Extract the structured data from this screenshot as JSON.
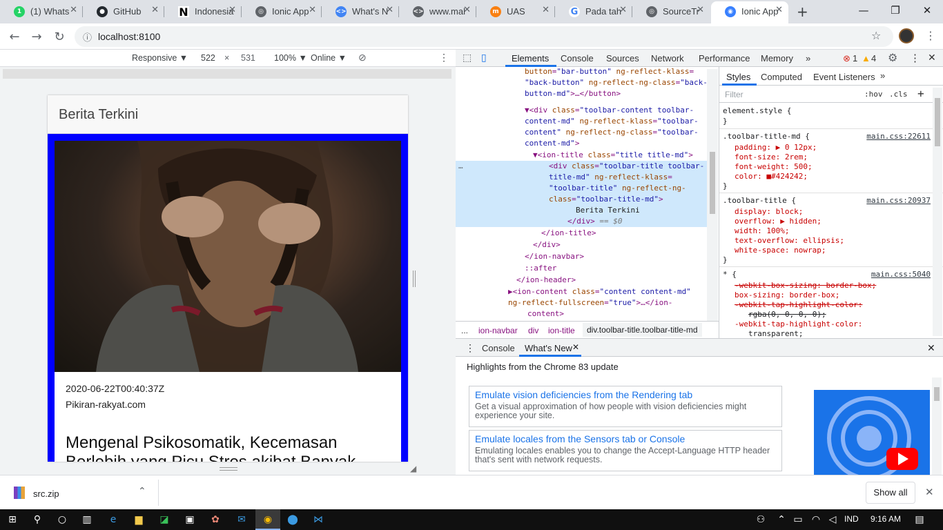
{
  "browser": {
    "tabs": [
      {
        "title": "(1) Whats",
        "favicon": "whatsapp-icon",
        "color": "#25d366"
      },
      {
        "title": "GitHub",
        "favicon": "github-icon",
        "color": "#24292e"
      },
      {
        "title": "Indonesia",
        "favicon": "notion-icon",
        "color": "#000000"
      },
      {
        "title": "Ionic App",
        "favicon": "globe-icon",
        "color": "#5f6368"
      },
      {
        "title": "What's N",
        "favicon": "devtools-icon",
        "color": "#4285f4"
      },
      {
        "title": "www.mal",
        "favicon": "code-icon",
        "color": "#5f6368"
      },
      {
        "title": "UAS",
        "favicon": "moodle-icon",
        "color": "#f98012"
      },
      {
        "title": "Pada tah",
        "favicon": "google-icon",
        "color": "#4285f4"
      },
      {
        "title": "SourceTr",
        "favicon": "globe-icon",
        "color": "#5f6368"
      },
      {
        "title": "Ionic App",
        "favicon": "ionic-icon",
        "color": "#3880ff"
      }
    ],
    "url": "localhost:8100"
  },
  "device_toolbar": {
    "mode": "Responsive ▼",
    "width": "522",
    "sep": "×",
    "height": "531",
    "zoom": "100% ▼",
    "network": "Online ▼"
  },
  "app": {
    "title": "Berita Terkini",
    "card": {
      "date": "2020-06-22T00:40:37Z",
      "source": "Pikiran-rakyat.com",
      "headline": "Mengenal Psikosomatik, Kecemasan Berlebih yang Picu Stres akibat Banyak"
    }
  },
  "devtools": {
    "tabs": [
      "Elements",
      "Console",
      "Sources",
      "Network",
      "Performance",
      "Memory",
      "»"
    ],
    "errors": "1",
    "warnings": "4",
    "breadcrumbs": [
      "...",
      "ion-navbar",
      "div",
      "ion-title",
      "div.toolbar-title.toolbar-title-md"
    ],
    "styles_tabs": [
      "Styles",
      "Computed",
      "Event Listeners",
      "»"
    ],
    "filter_placeholder": "Filter",
    "hov": ":hov",
    "cls": ".cls",
    "drawer_tabs": [
      "Console",
      "What's New"
    ],
    "whats_new_title": "Highlights from the Chrome 83 update",
    "whats_new": [
      {
        "title": "Emulate vision deficiencies from the Rendering tab",
        "desc": "Get a visual approximation of how people with vision deficiencies might experience your site."
      },
      {
        "title": "Emulate locales from the Sensors tab or Console",
        "desc": "Emulating locales enables you to change the Accept-Language HTTP header that's sent with network requests."
      }
    ],
    "elements_text": "Berita Terkini",
    "selected_marker": "== $0",
    "rules": [
      {
        "selector": "element.style {",
        "source": ""
      },
      {
        "selector": ".toolbar-title-md {",
        "source": "main.css:22611"
      },
      {
        "selector": ".toolbar-title {",
        "source": "main.css:20937"
      },
      {
        "selector": "* {",
        "source": "main.css:5040"
      }
    ],
    "decl": {
      "padding": "padding: ▶ 0 12px;",
      "font_size": "font-size: 2rem;",
      "font_weight": "font-weight: 500;",
      "color": "color: ■#424242;",
      "display": "display: block;",
      "overflow": "overflow: ▶ hidden;",
      "width": "width: 100%;",
      "text_overflow": "text-overflow: ellipsis;",
      "white_space": "white-space: nowrap;",
      "wbs": "-webkit-box-sizing: border-box;",
      "bs": "box-sizing: border-box;",
      "wthc": "-webkit-tap-highlight-color:",
      "wthc_val": "rgba(0, 0, 0, 0);",
      "wthc2": "-webkit-tap-highlight-color:",
      "wthc2_val": "transparent;"
    }
  },
  "downloads": {
    "file": "src.zip",
    "show_all": "Show all"
  },
  "taskbar": {
    "lang": "IND",
    "time": "9:16 AM"
  }
}
